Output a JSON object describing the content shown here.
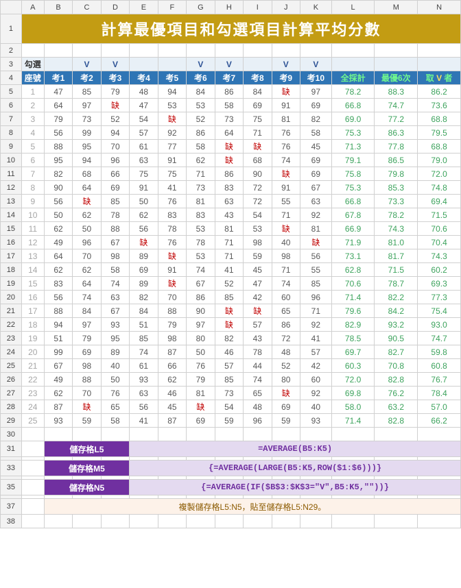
{
  "columns": [
    "A",
    "B",
    "C",
    "D",
    "E",
    "F",
    "G",
    "H",
    "I",
    "J",
    "K",
    "L",
    "M",
    "N"
  ],
  "title": "計算最優項目和勾選項目計算平均分數",
  "check_label": "勾選",
  "v": "V",
  "checks": [
    "",
    "V",
    "V",
    "",
    "",
    "V",
    "V",
    "",
    "V",
    "V"
  ],
  "headers": {
    "seat": "座號",
    "t1": "考1",
    "t2": "考2",
    "t3": "考3",
    "t4": "考4",
    "t5": "考5",
    "t6": "考6",
    "t7": "考7",
    "t8": "考8",
    "t9": "考9",
    "t10": "考10",
    "all": "全採計",
    "best": "最優6次",
    "vcol_a": "取",
    "vcol_b": "者"
  },
  "miss": "缺",
  "rows": [
    {
      "n": 1,
      "v": [
        47,
        85,
        79,
        48,
        94,
        84,
        86,
        84,
        "缺",
        97
      ],
      "a": 78.2,
      "b": 88.3,
      "c": 86.2
    },
    {
      "n": 2,
      "v": [
        64,
        97,
        "缺",
        47,
        53,
        53,
        58,
        69,
        91,
        69
      ],
      "a": 66.8,
      "b": 74.7,
      "c": 73.6
    },
    {
      "n": 3,
      "v": [
        79,
        73,
        52,
        54,
        "缺",
        52,
        73,
        75,
        81,
        82
      ],
      "a": 69.0,
      "b": 77.2,
      "c": 68.8
    },
    {
      "n": 4,
      "v": [
        56,
        99,
        94,
        57,
        92,
        86,
        64,
        71,
        76,
        58
      ],
      "a": 75.3,
      "b": 86.3,
      "c": 79.5
    },
    {
      "n": 5,
      "v": [
        88,
        95,
        70,
        61,
        77,
        58,
        "缺",
        "缺",
        76,
        45
      ],
      "a": 71.3,
      "b": 77.8,
      "c": 68.8
    },
    {
      "n": 6,
      "v": [
        95,
        94,
        96,
        63,
        91,
        62,
        "缺",
        68,
        74,
        69
      ],
      "a": 79.1,
      "b": 86.5,
      "c": 79.0
    },
    {
      "n": 7,
      "v": [
        82,
        68,
        66,
        75,
        75,
        71,
        86,
        90,
        "缺",
        69
      ],
      "a": 75.8,
      "b": 79.8,
      "c": 72.0
    },
    {
      "n": 8,
      "v": [
        90,
        64,
        69,
        91,
        41,
        73,
        83,
        72,
        91,
        67
      ],
      "a": 75.3,
      "b": 85.3,
      "c": 74.8
    },
    {
      "n": 9,
      "v": [
        56,
        "缺",
        85,
        50,
        76,
        81,
        63,
        72,
        55,
        63
      ],
      "a": 66.8,
      "b": 73.3,
      "c": 69.4
    },
    {
      "n": 10,
      "v": [
        50,
        62,
        78,
        62,
        83,
        83,
        43,
        54,
        71,
        92
      ],
      "a": 67.8,
      "b": 78.2,
      "c": 71.5
    },
    {
      "n": 11,
      "v": [
        62,
        50,
        88,
        56,
        78,
        53,
        81,
        53,
        "缺",
        81
      ],
      "a": 66.9,
      "b": 74.3,
      "c": 70.6
    },
    {
      "n": 12,
      "v": [
        49,
        96,
        67,
        "缺",
        76,
        78,
        71,
        98,
        40,
        "缺"
      ],
      "a": 71.9,
      "b": 81.0,
      "c": 70.4
    },
    {
      "n": 13,
      "v": [
        64,
        70,
        98,
        89,
        "缺",
        53,
        71,
        59,
        98,
        56
      ],
      "a": 73.1,
      "b": 81.7,
      "c": 74.3
    },
    {
      "n": 14,
      "v": [
        62,
        62,
        58,
        69,
        91,
        74,
        41,
        45,
        71,
        55
      ],
      "a": 62.8,
      "b": 71.5,
      "c": 60.2
    },
    {
      "n": 15,
      "v": [
        83,
        64,
        74,
        89,
        "缺",
        67,
        52,
        47,
        74,
        85
      ],
      "a": 70.6,
      "b": 78.7,
      "c": 69.3
    },
    {
      "n": 16,
      "v": [
        56,
        74,
        63,
        82,
        70,
        86,
        85,
        42,
        60,
        96
      ],
      "a": 71.4,
      "b": 82.2,
      "c": 77.3
    },
    {
      "n": 17,
      "v": [
        88,
        84,
        67,
        84,
        88,
        90,
        "缺",
        "缺",
        65,
        71
      ],
      "a": 79.6,
      "b": 84.2,
      "c": 75.4
    },
    {
      "n": 18,
      "v": [
        94,
        97,
        93,
        51,
        79,
        97,
        "缺",
        57,
        86,
        92
      ],
      "a": 82.9,
      "b": 93.2,
      "c": 93.0
    },
    {
      "n": 19,
      "v": [
        51,
        79,
        95,
        85,
        98,
        80,
        82,
        43,
        72,
        41
      ],
      "a": 78.5,
      "b": 90.5,
      "c": 74.7
    },
    {
      "n": 20,
      "v": [
        99,
        69,
        89,
        74,
        87,
        50,
        46,
        78,
        48,
        57
      ],
      "a": 69.7,
      "b": 82.7,
      "c": 59.8
    },
    {
      "n": 21,
      "v": [
        67,
        98,
        40,
        61,
        66,
        76,
        57,
        44,
        52,
        42
      ],
      "a": 60.3,
      "b": 70.8,
      "c": 60.8
    },
    {
      "n": 22,
      "v": [
        49,
        88,
        50,
        93,
        62,
        79,
        85,
        74,
        80,
        60
      ],
      "a": 72.0,
      "b": 82.8,
      "c": 76.7
    },
    {
      "n": 23,
      "v": [
        62,
        70,
        76,
        63,
        46,
        81,
        73,
        65,
        "缺",
        92
      ],
      "a": 69.8,
      "b": 76.2,
      "c": 78.4
    },
    {
      "n": 24,
      "v": [
        87,
        "缺",
        65,
        56,
        45,
        "缺",
        54,
        48,
        69,
        40
      ],
      "a": 58.0,
      "b": 63.2,
      "c": 57.0
    },
    {
      "n": 25,
      "v": [
        93,
        59,
        58,
        41,
        87,
        69,
        59,
        96,
        59,
        93
      ],
      "a": 71.4,
      "b": 82.8,
      "c": 66.2
    }
  ],
  "formula_boxes": [
    {
      "label": "儲存格L5",
      "txt": "=AVERAGE(B5:K5)"
    },
    {
      "label": "儲存格M5",
      "txt": "{=AVERAGE(LARGE(B5:K5,ROW($1:$6)))}"
    },
    {
      "label": "儲存格N5",
      "txt": "{=AVERAGE(IF($B$3:$K$3=\"V\",B5:K5,\"\"))}"
    }
  ],
  "note": "複製儲存格L5:N5，貼至儲存格L5:N29。"
}
